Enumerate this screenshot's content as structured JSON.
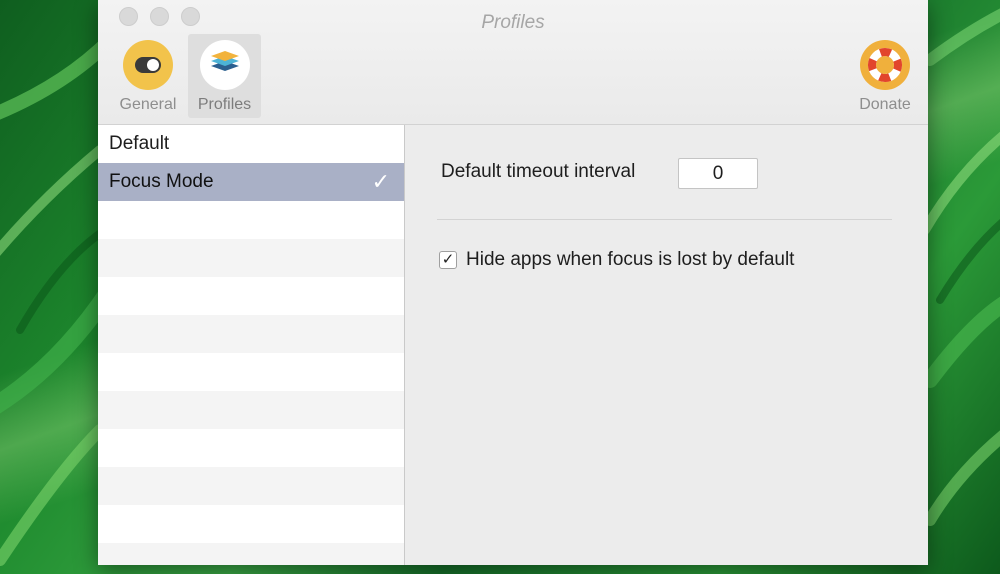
{
  "window": {
    "title": "Profiles"
  },
  "toolbar": {
    "general_label": "General",
    "profiles_label": "Profiles",
    "donate_label": "Donate"
  },
  "sidebar": {
    "items": [
      {
        "label": "Default",
        "selected": false
      },
      {
        "label": "Focus Mode",
        "selected": true,
        "check": "✓"
      }
    ]
  },
  "detail": {
    "timeout_label": "Default timeout interval",
    "timeout_value": "0",
    "hide_apps_label": "Hide apps when focus is lost by default",
    "hide_apps_checked": true,
    "check_glyph": "✓"
  },
  "colors": {
    "selection": "#a9b0c6",
    "icon_yellow": "#f2c34b",
    "icon_donate_orange": "#f0b03c",
    "wallpaper_green": "#2e8b3a"
  },
  "icons": {
    "general": "toggle-switch-icon",
    "profiles": "stacked-layers-icon",
    "donate": "lifebuoy-icon"
  }
}
